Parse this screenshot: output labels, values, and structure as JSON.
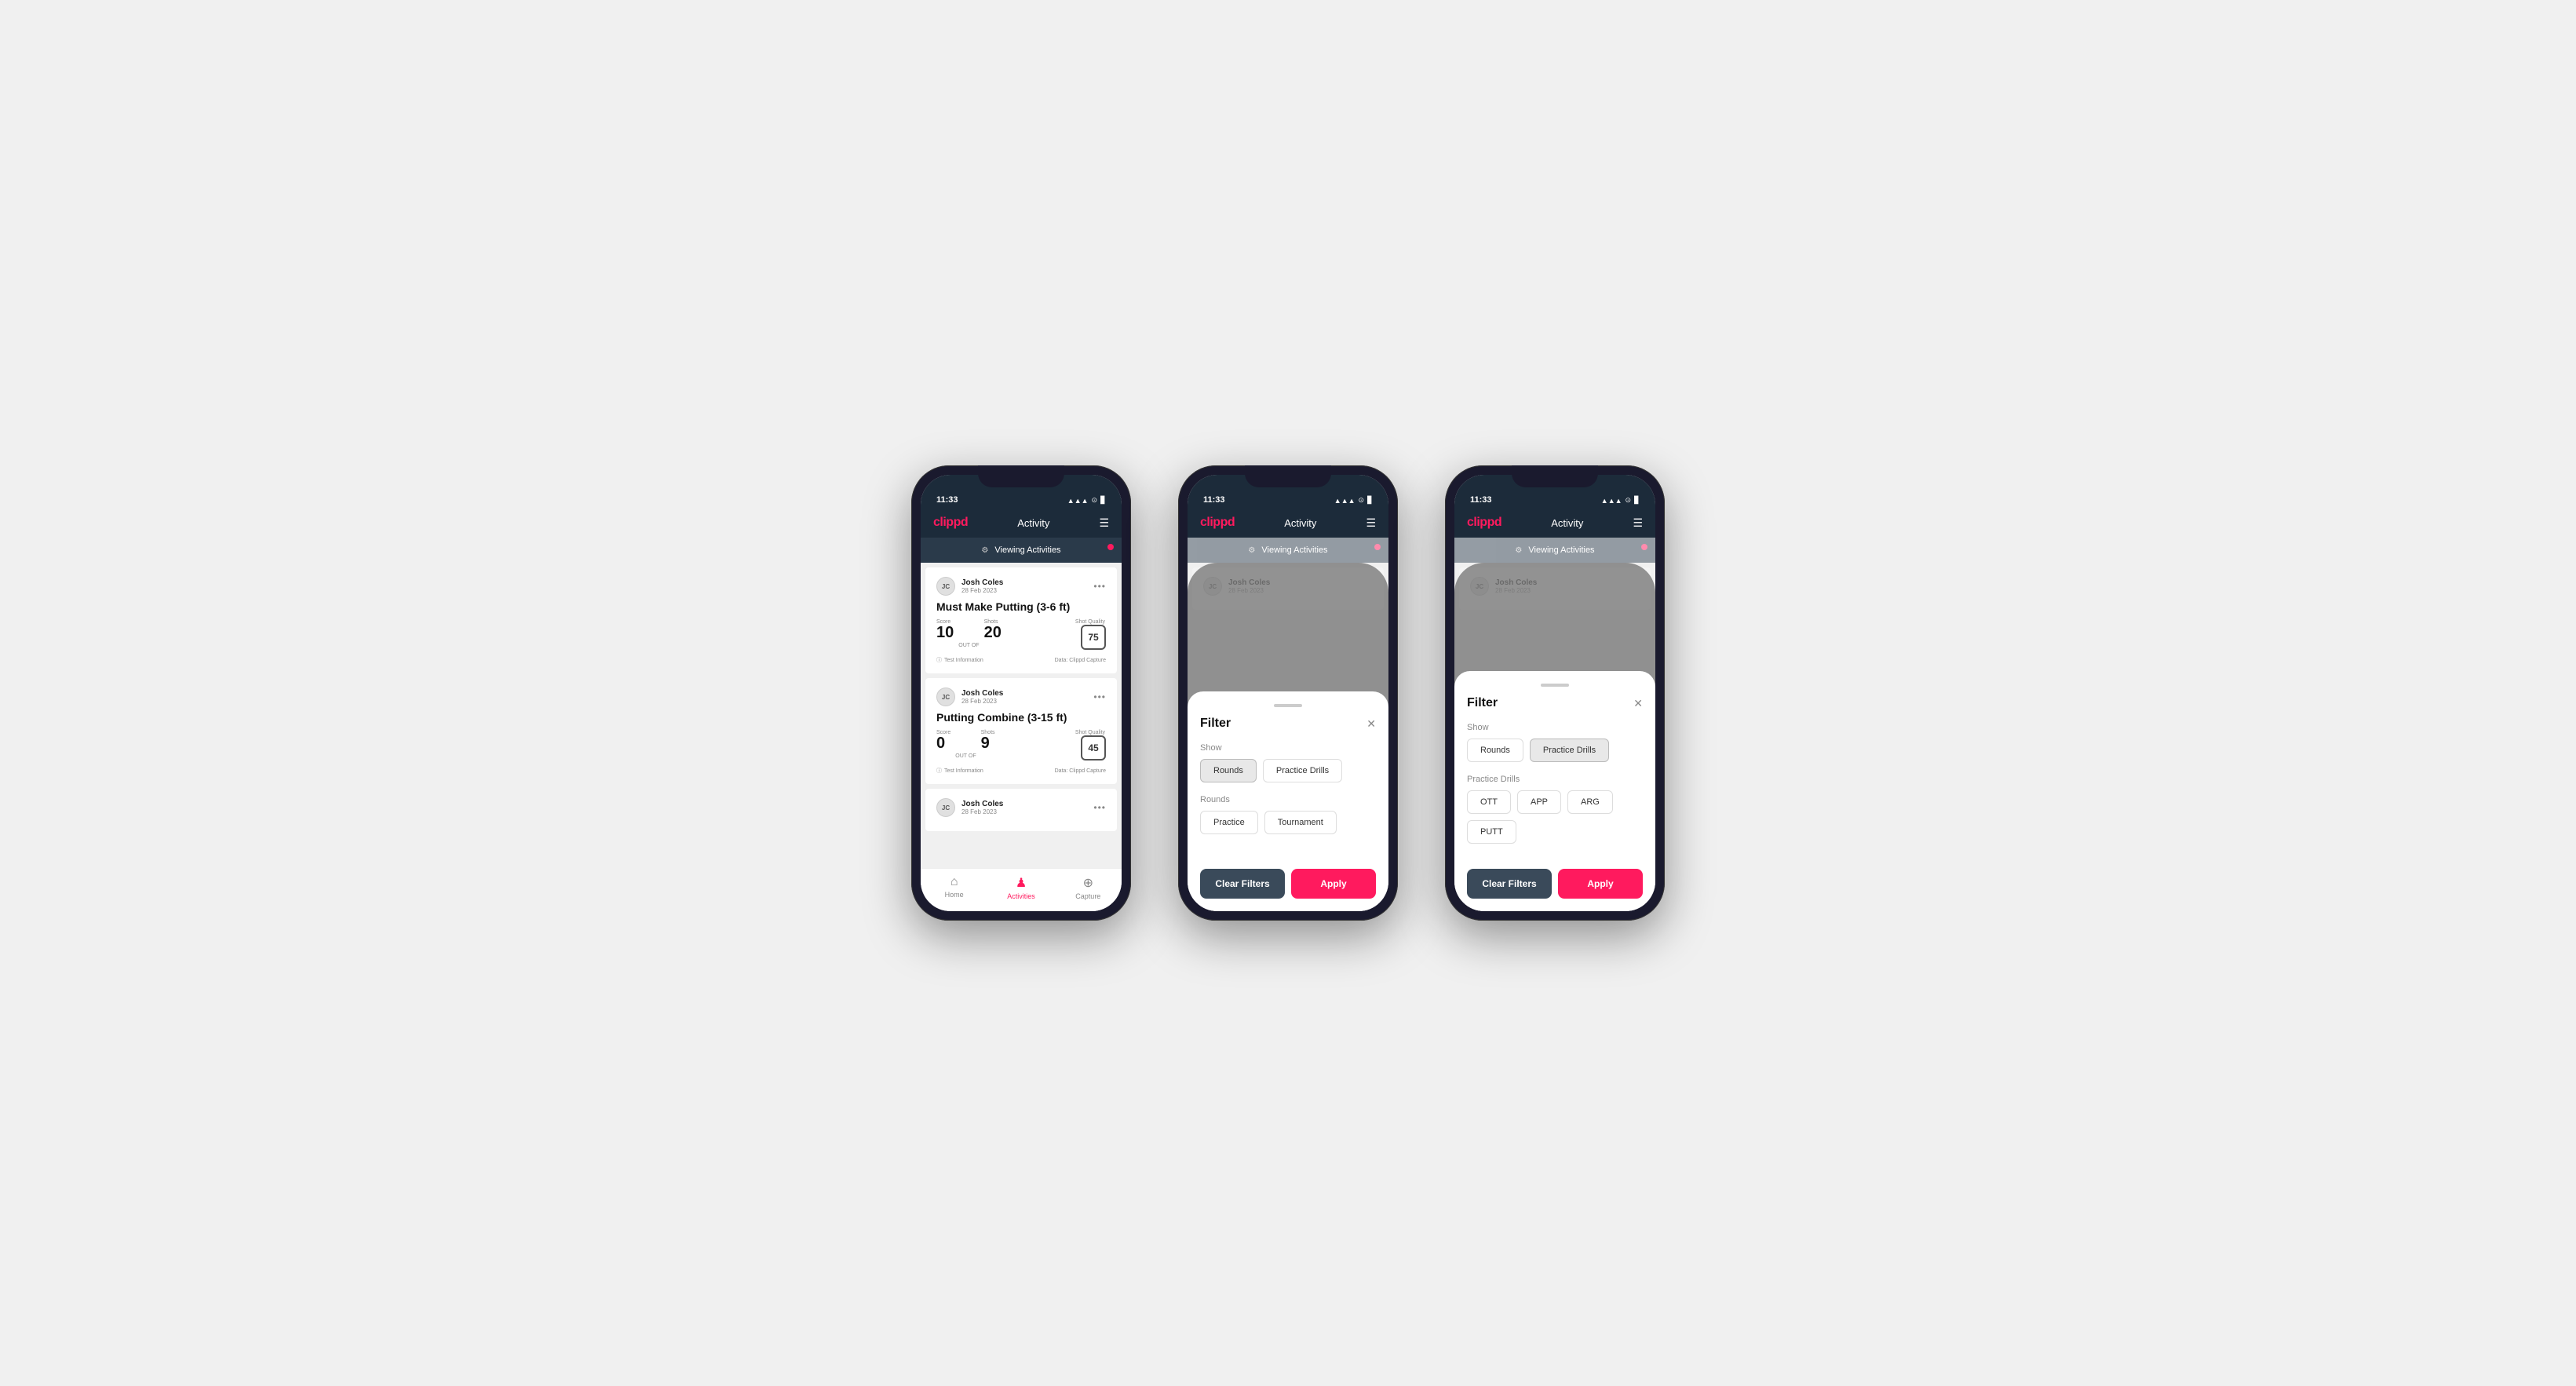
{
  "app": {
    "logo": "clippd",
    "title": "Activity",
    "time": "11:33",
    "status_icons": [
      "▲▲▲",
      "wifi",
      "battery"
    ]
  },
  "phone1": {
    "viewing_banner": "Viewing Activities",
    "activities": [
      {
        "user_name": "Josh Coles",
        "user_date": "28 Feb 2023",
        "title": "Must Make Putting (3-6 ft)",
        "score_label": "Score",
        "score_value": "10",
        "shots_label": "Shots",
        "shots_value": "20",
        "shot_quality_label": "Shot Quality",
        "shot_quality_value": "75",
        "info_text": "Test Information",
        "data_source": "Data: Clippd Capture"
      },
      {
        "user_name": "Josh Coles",
        "user_date": "28 Feb 2023",
        "title": "Putting Combine (3-15 ft)",
        "score_label": "Score",
        "score_value": "0",
        "shots_label": "Shots",
        "shots_value": "9",
        "shot_quality_label": "Shot Quality",
        "shot_quality_value": "45",
        "info_text": "Test Information",
        "data_source": "Data: Clippd Capture"
      },
      {
        "user_name": "Josh Coles",
        "user_date": "28 Feb 2023",
        "title": "",
        "score_label": "",
        "score_value": "",
        "shots_label": "",
        "shots_value": "",
        "shot_quality_label": "",
        "shot_quality_value": "",
        "info_text": "",
        "data_source": ""
      }
    ],
    "nav": {
      "home_label": "Home",
      "activities_label": "Activities",
      "capture_label": "Capture"
    }
  },
  "phone2": {
    "viewing_banner": "Viewing Activities",
    "filter": {
      "title": "Filter",
      "show_label": "Show",
      "rounds_btn": "Rounds",
      "practice_drills_btn": "Practice Drills",
      "rounds_section_label": "Rounds",
      "practice_btn": "Practice",
      "tournament_btn": "Tournament",
      "clear_filters_btn": "Clear Filters",
      "apply_btn": "Apply",
      "active_tab": "rounds"
    }
  },
  "phone3": {
    "viewing_banner": "Viewing Activities",
    "filter": {
      "title": "Filter",
      "show_label": "Show",
      "rounds_btn": "Rounds",
      "practice_drills_btn": "Practice Drills",
      "practice_drills_section_label": "Practice Drills",
      "ott_btn": "OTT",
      "app_btn": "APP",
      "arg_btn": "ARG",
      "putt_btn": "PUTT",
      "clear_filters_btn": "Clear Filters",
      "apply_btn": "Apply",
      "active_tab": "practice_drills"
    }
  }
}
